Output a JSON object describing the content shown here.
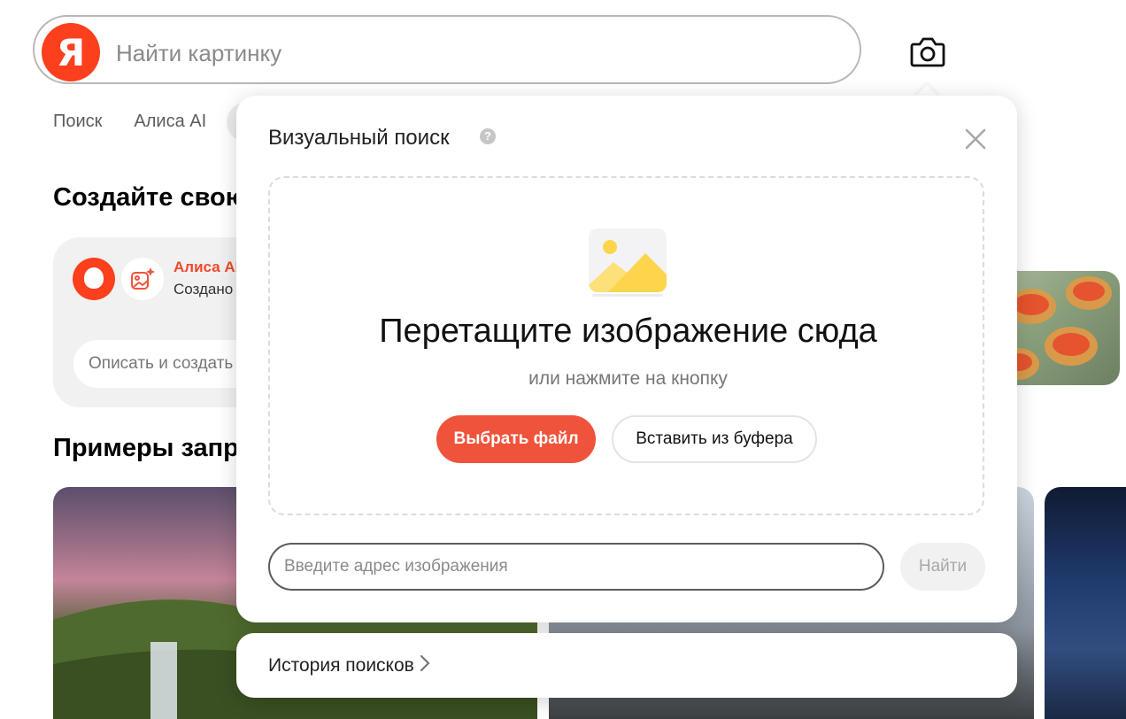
{
  "search": {
    "logo_letter": "Я",
    "placeholder": "Найти картинку"
  },
  "nav": {
    "tabs": [
      {
        "label": "Поиск"
      },
      {
        "label": "Алиса AI"
      }
    ]
  },
  "sections": {
    "create_title": "Создайте свою",
    "examples_title": "Примеры запросов"
  },
  "create_card": {
    "alice_name": "Алиса AI",
    "alice_sub": "Создано",
    "describe_placeholder": "Описать и создать"
  },
  "visual_search": {
    "title": "Визуальный поиск",
    "help_icon": "?",
    "drop_title": "Перетащите изображение сюда",
    "drop_subtitle": "или нажмите на кнопку",
    "choose_file_label": "Выбрать файл",
    "paste_label": "Вставить из буфера",
    "url_placeholder": "Введите адрес изображения",
    "find_label": "Найти",
    "history_label": "История поисков"
  },
  "colors": {
    "accent": "#f0533b",
    "logo": "#fc3f1d"
  },
  "icons": [
    "camera-icon",
    "close-icon",
    "picture-icon",
    "help-icon",
    "chevron-right-icon",
    "alice-icon",
    "image-generation-icon"
  ]
}
